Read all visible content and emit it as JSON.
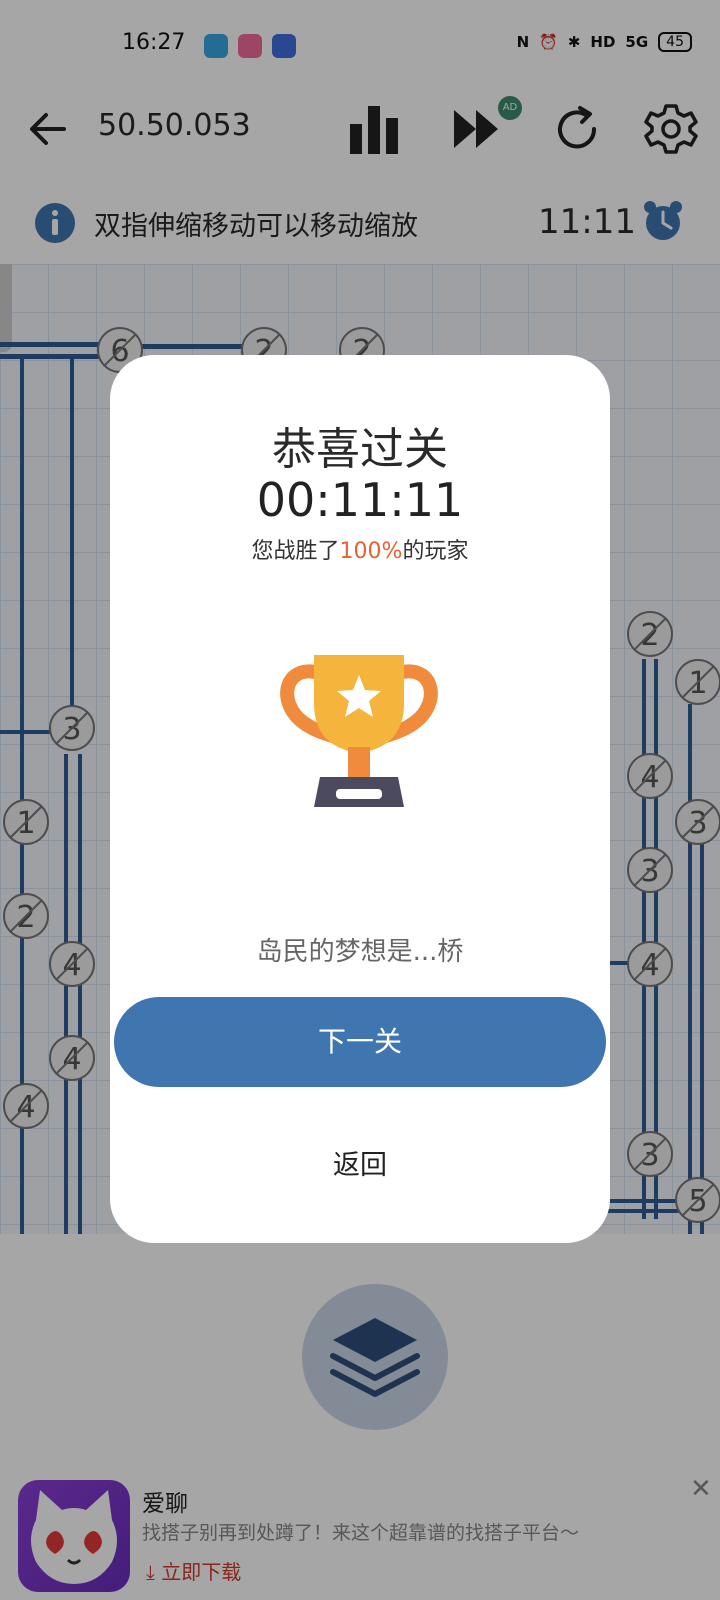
{
  "status_bar": {
    "time": "16:27",
    "battery": "45",
    "signal_label": "5G",
    "hd_label": "HD"
  },
  "toolbar": {
    "level": "50.50.053",
    "ad_badge": "AD",
    "icons": [
      "back-arrow-icon",
      "stats-icon",
      "fast-forward-icon",
      "refresh-icon",
      "settings-icon"
    ]
  },
  "info_bar": {
    "hint": "双指伸缩移动可以移动缩放",
    "timer": "11:11"
  },
  "board": {
    "islands": [
      "6",
      "2",
      "2",
      "3",
      "1",
      "2",
      "4",
      "4",
      "4",
      "2",
      "1",
      "4",
      "3",
      "3",
      "4",
      "3",
      "5"
    ]
  },
  "dialog": {
    "title": "恭喜过关",
    "time": "00:11:11",
    "subtitle_prefix": "您战胜了",
    "subtitle_percent": "100%",
    "subtitle_suffix": "的玩家",
    "note": "岛民的梦想是...桥",
    "next_button": "下一关",
    "back_button": "返回"
  },
  "ad": {
    "title": "爱聊",
    "description": "找搭子别再到处蹲了！来这个超靠谱的找搭子平台～",
    "download": "立即下载",
    "close": "✕"
  },
  "colors": {
    "accent_blue": "#3f76b0",
    "percent_orange": "#e8622d",
    "bridge_blue": "#2f5d95",
    "trophy_gold": "#f5b43c"
  }
}
